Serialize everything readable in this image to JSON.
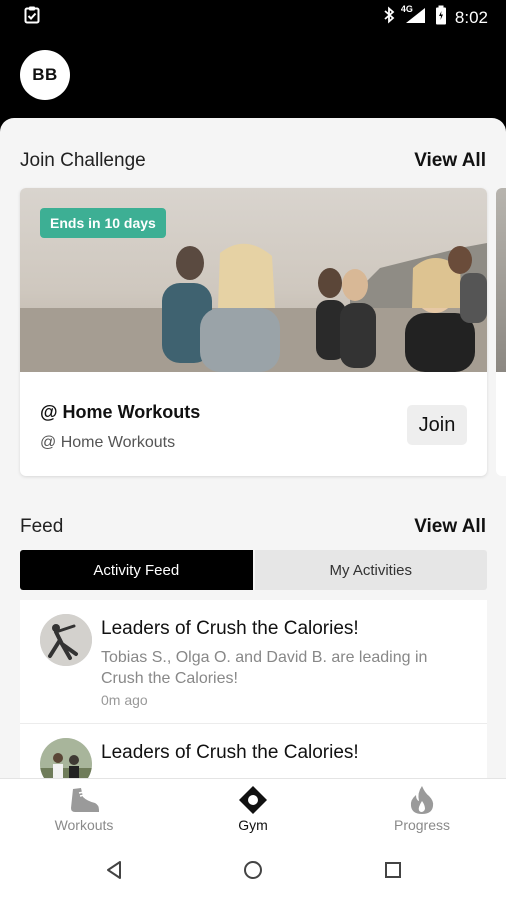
{
  "status_bar": {
    "time": "8:02",
    "network": "4G",
    "icons": [
      "clipboard-check-icon",
      "bluetooth-icon",
      "signal-icon",
      "battery-icon"
    ]
  },
  "header": {
    "avatar_initials": "BB"
  },
  "challenges": {
    "title": "Join Challenge",
    "view_all": "View All",
    "cards": [
      {
        "badge": "Ends in 10 days",
        "title": "@ Home Workouts",
        "subtitle": "@ Home Workouts",
        "join_label": "Join"
      }
    ]
  },
  "feed": {
    "title": "Feed",
    "view_all": "View All",
    "tabs": [
      {
        "label": "Activity Feed",
        "active": true
      },
      {
        "label": "My Activities",
        "active": false
      }
    ],
    "items": [
      {
        "title": "Leaders of Crush the Calories!",
        "text": "Tobias S., Olga O. and David B. are leading in Crush the Calories!",
        "time": "0m ago"
      },
      {
        "title": "Leaders of Crush the Calories!",
        "text": "",
        "time": ""
      }
    ]
  },
  "bottom_nav": {
    "items": [
      {
        "label": "Workouts",
        "icon": "shoe-icon",
        "active": false
      },
      {
        "label": "Gym",
        "icon": "location-diamond-icon",
        "active": true
      },
      {
        "label": "Progress",
        "icon": "flame-icon",
        "active": false
      }
    ]
  },
  "colors": {
    "accent_badge": "#3daf94",
    "header_bg": "#000000",
    "active_tab": "#000000",
    "inactive_tab": "#e6e6e6"
  }
}
